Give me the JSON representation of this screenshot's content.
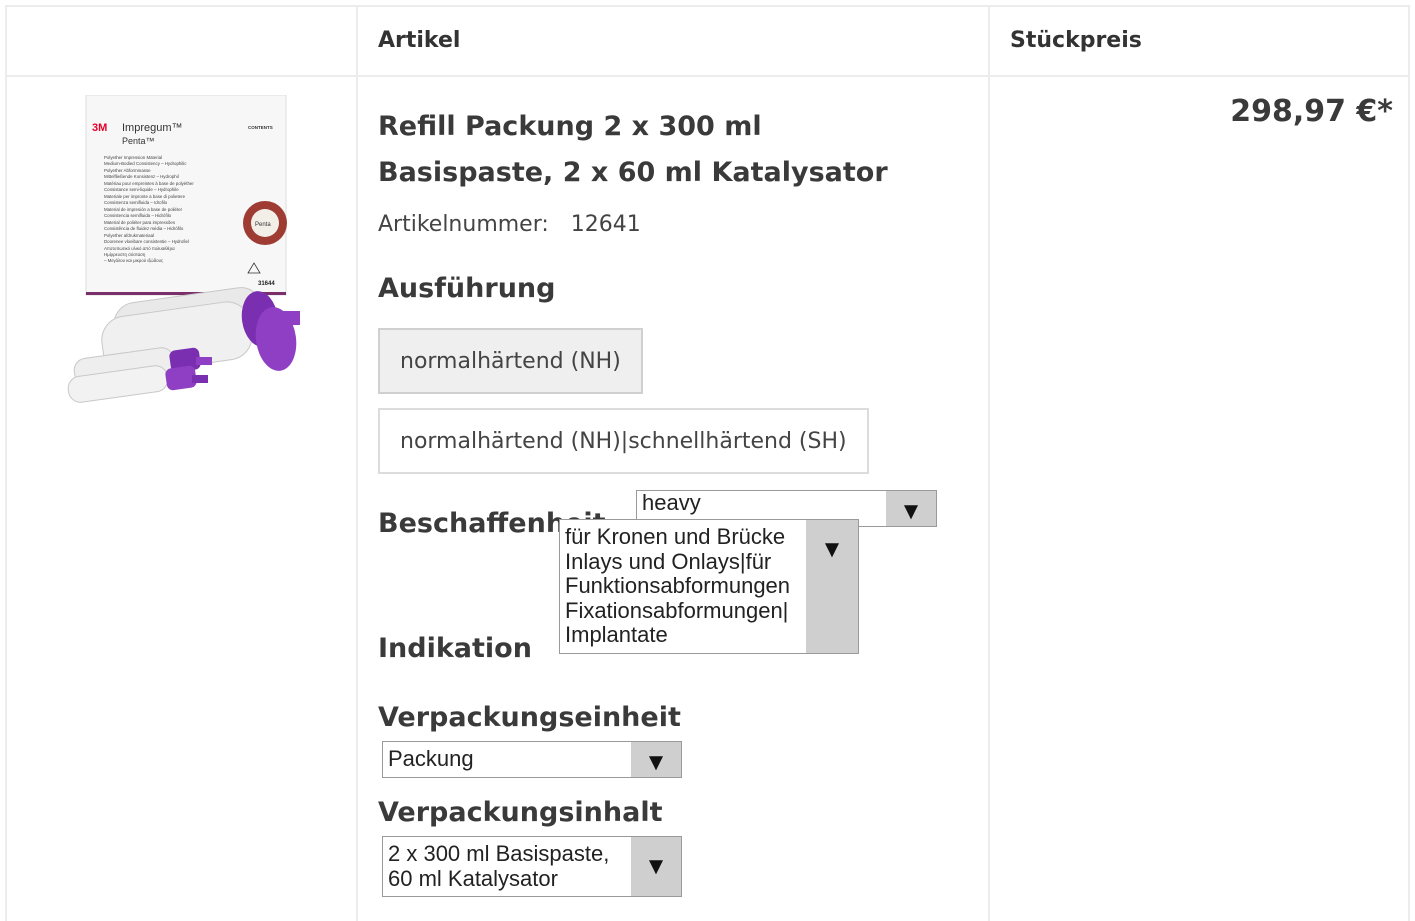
{
  "table": {
    "headers": {
      "article": "Artikel",
      "unit_price": "Stückpreis"
    }
  },
  "product": {
    "image": {
      "brand": "3M",
      "name": "Impregum™",
      "sub": "Penta™",
      "lines": [
        "Polyether Impression Material",
        "Medium-Bodied Consistency – Hydrophilic",
        "Polyether Abformmasse",
        "Mittelfließende Konsistenz – Hydrophil",
        "Matériau pour empreintes à base de polyéther",
        "Consistance semi-liquide – Hydrophile",
        "Materiale per impronte a base di polietere",
        "Consistenza semifluida – Idrofilo",
        "Material de impresión a base de poliéter",
        "Consistencia semifluida – Hidrófilo",
        "Material de poliéter para impressões",
        "Consistência de fluidez média – Hidrófilo",
        "Polyether afdrukmateriaal",
        "Doorenee vloeibare consistentie – Hydrofiel",
        "Αποτυπωτικό υλικό από πολυαιθέρα",
        "Ημίρρευστη σύσταση",
        "– Μεγάλου και μικρού ιξώδους"
      ],
      "contents_label": "CONTENTS",
      "ref": "31644",
      "seal": "Penta"
    },
    "title_line1": "Refill Packung 2 x 300 ml",
    "title_line2": "Basispaste, 2 x 60 ml Katalysator",
    "article_number_label": "Artikelnummer:",
    "article_number": "12641",
    "price": "298,97 €*"
  },
  "options": {
    "ausfuehrung_label": "Ausführung",
    "ausfuehrung": [
      "normalhärtend (NH)",
      "normalhärtend (NH)|schnellhärtend (SH)"
    ],
    "beschaffenheit_label": "Beschaffenheit",
    "beschaffenheit_value": "heavy",
    "indikation_label": "Indikation",
    "indikation_value_lines": [
      "für Kronen und Brücke",
      "Inlays und Onlays|für",
      "Funktionsabformungen",
      "Fixationsabformungen|",
      "Implantate"
    ],
    "verpackungseinheit_label": "Verpackungseinheit",
    "verpackungseinheit_value": "Packung",
    "verpackungsinhalt_label": "Verpackungsinhalt",
    "verpackungsinhalt_value_lines": [
      "2 x 300 ml Basispaste,",
      "60 ml Katalysator"
    ]
  },
  "icons": {
    "dropdown": "chevron-down-icon"
  },
  "colors": {
    "border": "#ececec",
    "select_arrow_bg": "#cfcfcf",
    "accent_purple": "#7a2fb0"
  }
}
